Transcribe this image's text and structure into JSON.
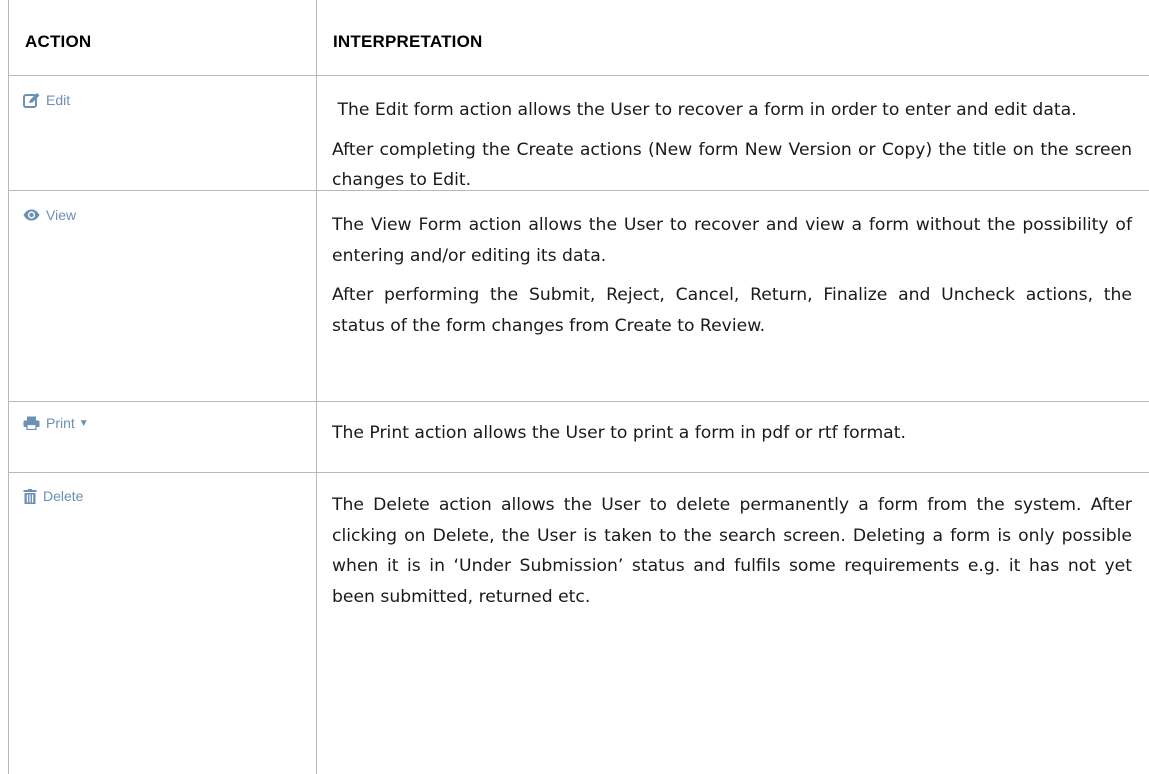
{
  "headers": {
    "action": "ACTION",
    "interpretation": "INTERPRETATION"
  },
  "rows": [
    {
      "action_label": "Edit",
      "icon": "edit-icon",
      "paragraphs": [
        " The Edit form action allows the User to recover a form in order to enter and edit data.",
        "After completing the Create actions (New form New Version or Copy) the title on the screen changes to Edit."
      ]
    },
    {
      "action_label": "View",
      "icon": "eye-icon",
      "paragraphs": [
        "The View Form action allows the User to recover and view a form without the possibility of entering and/or editing its data.",
        "After performing the Submit, Reject, Cancel, Return, Finalize and Uncheck actions, the status of the form changes from Create to Review."
      ]
    },
    {
      "action_label": "Print",
      "icon": "printer-icon",
      "paragraphs": [
        "The Print action allows the User to print a form in pdf or rtf format."
      ]
    },
    {
      "action_label": "Delete",
      "icon": "trash-icon",
      "paragraphs": [
        "The Delete action allows the User to delete permanently a form from the system. After clicking on Delete, the User is taken to the search screen. Deleting a form is only possible when it is in ‘Under Submission’ status and fulfils some requirements e.g. it has not yet been submitted, returned etc."
      ]
    }
  ],
  "colors": {
    "action_link": "#6b8fb5",
    "border": "#b8b8b8",
    "text": "#1a1a1a"
  }
}
